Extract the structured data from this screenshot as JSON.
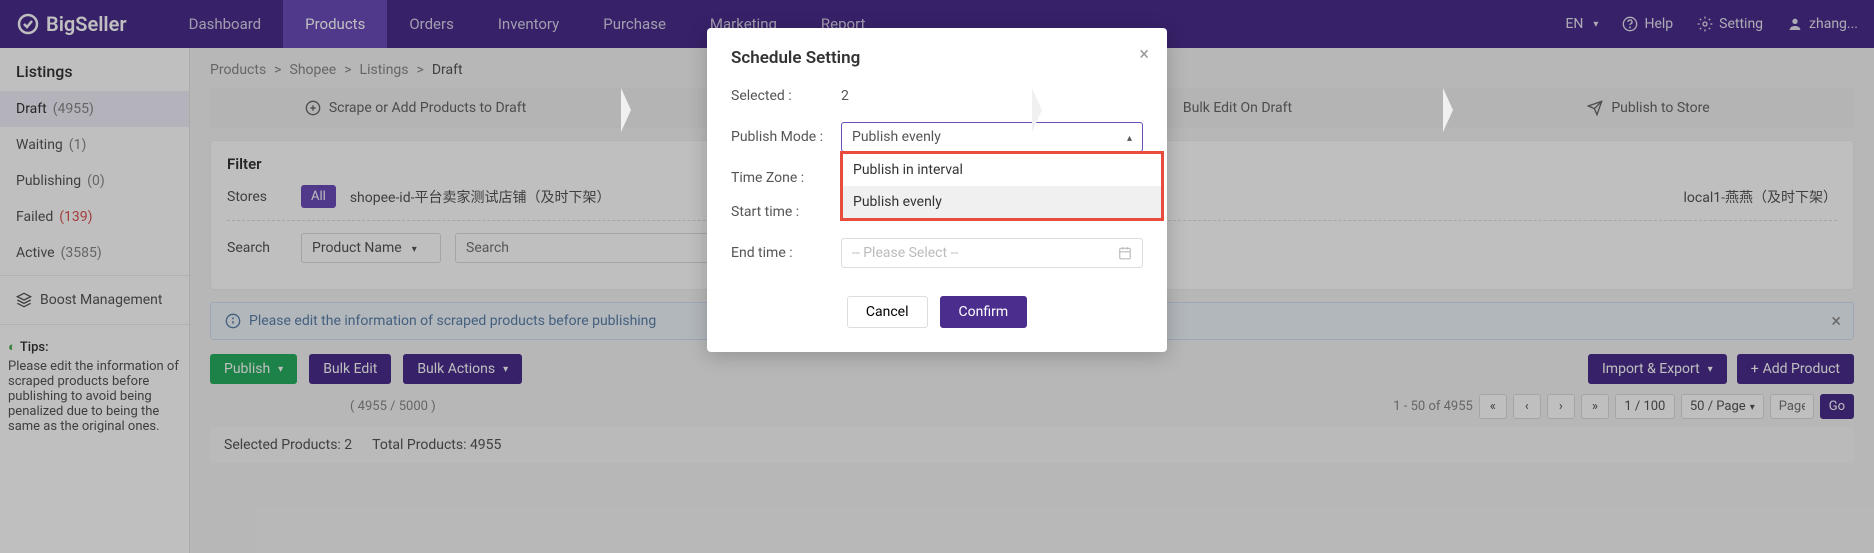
{
  "logo": "BigSeller",
  "nav": [
    "Dashboard",
    "Products",
    "Orders",
    "Inventory",
    "Purchase",
    "Marketing",
    "Report"
  ],
  "topright": {
    "lang": "EN",
    "help": "Help",
    "setting": "Setting",
    "user": "zhang..."
  },
  "sidebar": {
    "heading": "Listings",
    "items": [
      {
        "label": "Draft",
        "count": "(4955)"
      },
      {
        "label": "Waiting",
        "count": "(1)"
      },
      {
        "label": "Publishing",
        "count": "(0)"
      },
      {
        "label": "Failed",
        "count": "(139)"
      },
      {
        "label": "Active",
        "count": "(3585)"
      }
    ],
    "boost": "Boost Management"
  },
  "tips": {
    "title": "Tips:",
    "body": "Please edit the information of scraped products before publishing to avoid being penalized due to being the same as the original ones."
  },
  "breadcrumb": [
    "Products",
    "Shopee",
    "Listings",
    "Draft"
  ],
  "steps": [
    "Scrape or Add Products to Draft",
    "",
    "Bulk Edit On Draft",
    "Publish to Store"
  ],
  "filter": {
    "title": "Filter",
    "storesLabel": "Stores",
    "all": "All",
    "stores": [
      "shopee-id-平台卖家测试店铺（及时下架）",
      "local1-燕燕（及时下架）"
    ],
    "searchLabel": "Search",
    "searchField": "Product Name",
    "searchPlaceholder": "Search"
  },
  "alert": "Please edit the information of scraped products before publishing",
  "actions": {
    "publish": "Publish",
    "bulkEdit": "Bulk Edit",
    "bulkActions": "Bulk Actions",
    "importExport": "Import & Export",
    "addProduct": "Add Product"
  },
  "counts": "( 4955 / 5000 )",
  "pager": {
    "range": "1 - 50 of 4955",
    "pages": "1 / 100",
    "perPage": "50 / Page",
    "page": "Page",
    "go": "Go"
  },
  "selectedRow": {
    "selected": "Selected Products: 2",
    "total": "Total Products: 4955"
  },
  "modal": {
    "title": "Schedule Setting",
    "selectedLabel": "Selected :",
    "selectedVal": "2",
    "publishModeLabel": "Publish Mode :",
    "publishModeVal": "Publish evenly",
    "opts": [
      "Publish in interval",
      "Publish evenly"
    ],
    "timezoneLabel": "Time Zone :",
    "startLabel": "Start time :",
    "endLabel": "End time :",
    "endPlaceholder": "-- Please Select --",
    "cancel": "Cancel",
    "confirm": "Confirm"
  }
}
